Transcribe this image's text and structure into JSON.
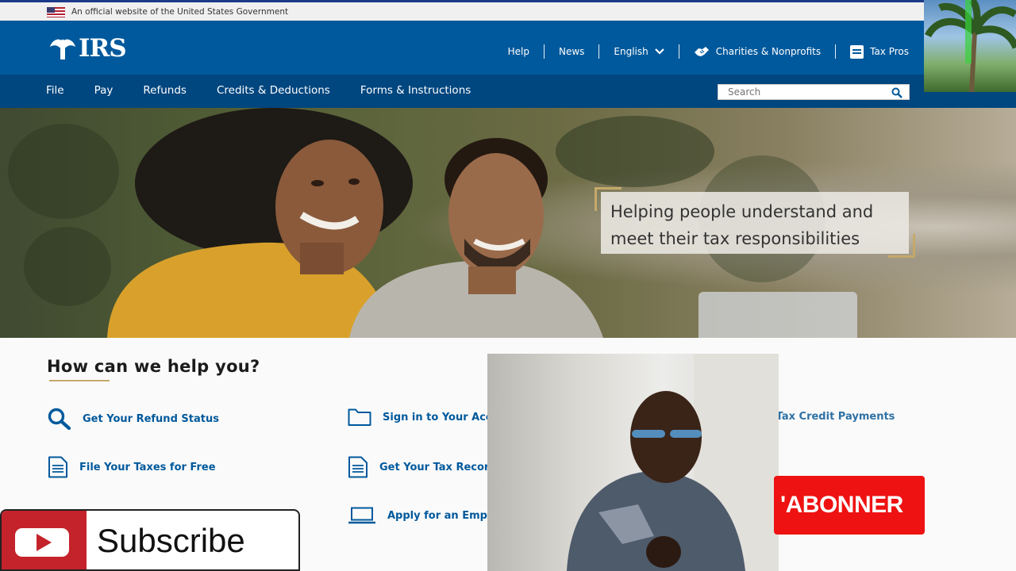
{
  "gov_banner": {
    "text": "An official website of the United States Government"
  },
  "header": {
    "logo_text": "IRS",
    "utility_nav": [
      {
        "label": "Help"
      },
      {
        "label": "News"
      },
      {
        "label": "English",
        "has_dropdown": true
      },
      {
        "label": "Charities & Nonprofits",
        "icon": "handshake-icon"
      },
      {
        "label": "Tax Pros",
        "icon": "id-card-icon"
      }
    ]
  },
  "main_nav": {
    "items": [
      "File",
      "Pay",
      "Refunds",
      "Credits & Deductions",
      "Forms & Instructions"
    ],
    "search_placeholder": "Search"
  },
  "hero": {
    "callout_line1": "Helping people understand and",
    "callout_line2": "meet their tax responsibilities"
  },
  "help": {
    "title": "How can we help you?",
    "links": [
      {
        "label": "Get Your Refund Status",
        "icon": "search-icon"
      },
      {
        "label": "Sign in to Your Account",
        "icon": "folder-icon"
      },
      {
        "label": "u Your Child Tax Credit Payments",
        "icon": "none"
      },
      {
        "label": "File Your Taxes for Free",
        "icon": "document-icon"
      },
      {
        "label": "Get Your Tax Record",
        "icon": "document-icon"
      },
      {
        "label": "Apply for an Employer ID Nu",
        "icon": "laptop-icon"
      }
    ]
  },
  "overlays": {
    "subscribe_label": "Subscribe",
    "abonner_label": "'ABONNER",
    "colors": {
      "youtube_red": "#c4232b",
      "abonner_red": "#ee1212"
    }
  },
  "colors": {
    "header_blue": "#00599c",
    "nav_blue": "#00467f",
    "gold_accent": "#c5a96a",
    "link_blue": "#00599c"
  }
}
